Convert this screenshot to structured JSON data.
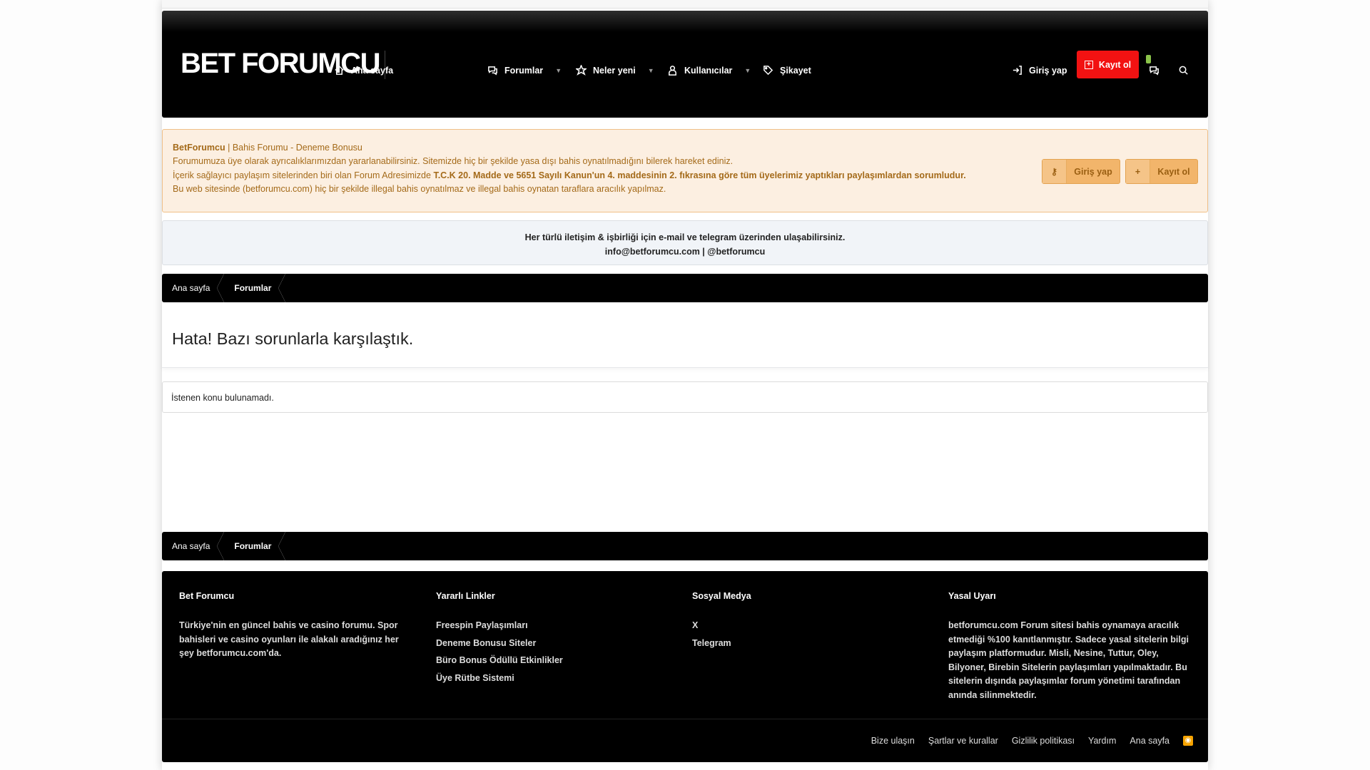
{
  "header": {
    "logo": "BET FORUMCU",
    "nav": [
      {
        "label": "Ana sayfa",
        "icon": "home-icon"
      },
      {
        "label": "Forumlar",
        "icon": "comments-icon",
        "dropdown": true
      },
      {
        "label": "Neler yeni",
        "icon": "star-icon",
        "dropdown": true
      },
      {
        "label": "Kullanıcılar",
        "icon": "user-icon",
        "dropdown": true
      },
      {
        "label": "Şikayet",
        "icon": "tag-icon"
      }
    ],
    "login": "Giriş yap",
    "register": "Kayıt ol"
  },
  "notice": {
    "brand": "BetForumcu",
    "tagline": " | Bahis Forumu - Deneme Bonusu",
    "line2": "Forumumuza üye olarak ayrıcalıklarımızdan yararlanabilirsiniz. Sitemizde hiç bir şekilde yasa dışı bahis oynatılmadığını bilerek hareket ediniz.",
    "line3_prefix": "İçerik sağlayıcı paylaşım sitelerinden biri olan Forum Adresimizde ",
    "line3_bold": "T.C.K 20. Madde ve 5651 Sayılı Kanun'un 4. maddesinin 2. fıkrasına göre tüm üyelerimiz yaptıkları paylaşımlardan sorumludur.",
    "line4": "Bu web sitesinde (betforumcu.com) hiç bir şekilde illegal bahis oynatılmaz ve illegal bahis oynatan taraflara aracılık yapılmaz.",
    "login": "Giriş yap",
    "register": "Kayıt ol"
  },
  "contact": {
    "line1": "Her türlü iletişim & işbirliği için e-mail ve telegram üzerinden ulaşabilirsiniz.",
    "line2": "info@betforumcu.com | @betforumcu"
  },
  "breadcrumb": [
    "Ana sayfa",
    "Forumlar"
  ],
  "main": {
    "title": "Hata! Bazı sorunlarla karşılaştık.",
    "message": "İstenen konu bulunamadı."
  },
  "footer": {
    "col1": {
      "title": "Bet Forumcu",
      "text": "Türkiye'nin en güncel bahis ve casino forumu. Spor bahisleri ve casino oyunları ile alakalı aradığınız her şey betforumcu.com'da."
    },
    "col2": {
      "title": "Yararlı Linkler",
      "links": [
        "Freespin Paylaşımları",
        "Deneme Bonusu Siteler",
        "Büro Bonus Ödüllü Etkinlikler",
        "Üye Rütbe Sistemi"
      ]
    },
    "col3": {
      "title": "Sosyal Medya",
      "links": [
        "X",
        "Telegram"
      ]
    },
    "col4": {
      "title": "Yasal Uyarı",
      "text": "betforumcu.com Forum sitesi bahis oynamaya aracılık etmediği %100 kanıtlanmıştır. Sadece yasal sitelerin bilgi paylaşım platformudur. Misli, Nesine, Tuttur, Oley, Bilyoner, Birebin Sitelerin paylaşımları yapılmaktadır. Bu sitelerin dışında paylaşımlar forum yönetimi tarafından anında silinmektedir."
    },
    "links": [
      "Bize ulaşın",
      "Şartlar ve kurallar",
      "Gizlilik politikası",
      "Yardım",
      "Ana sayfa"
    ]
  }
}
